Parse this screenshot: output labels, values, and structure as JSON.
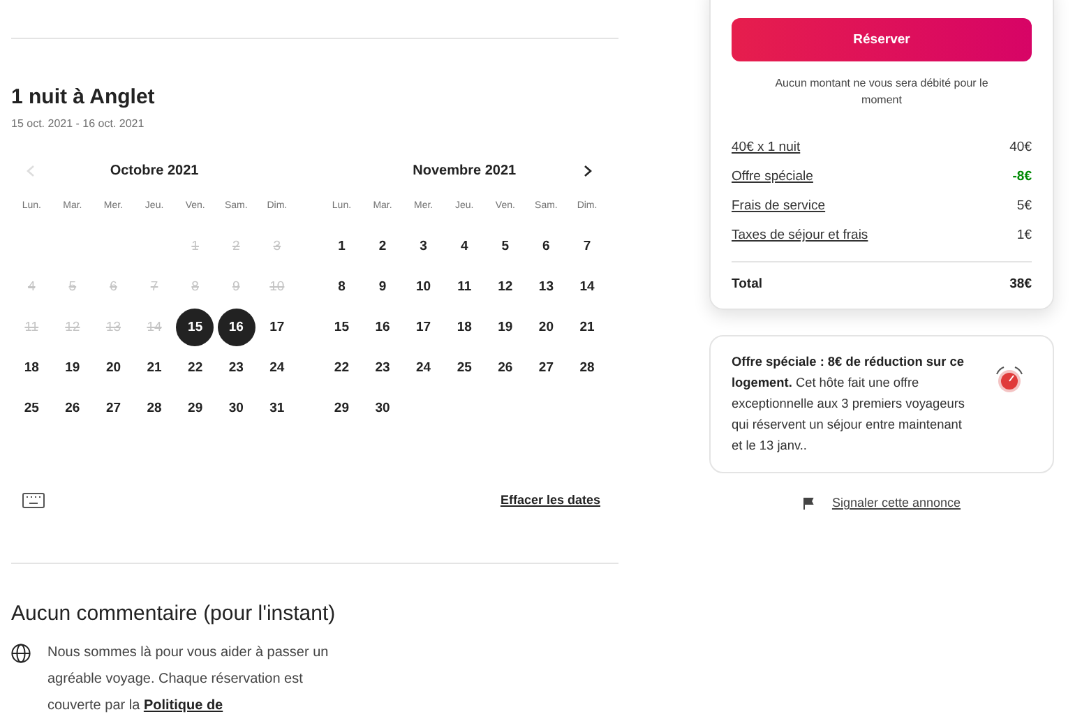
{
  "stay": {
    "title": "1 nuit à Anglet",
    "dates": "15 oct. 2021 - 16 oct. 2021"
  },
  "calendar": {
    "months": [
      {
        "title": "Octobre  2021",
        "prev_arrow": {
          "disabled": true
        },
        "weekdays": [
          "Lun.",
          "Mar.",
          "Mer.",
          "Jeu.",
          "Ven.",
          "Sam.",
          "Dim."
        ],
        "weeks": [
          {
            "right_aligned": true,
            "days": [
              {
                "label": "1",
                "disabled": true,
                "selected": false
              },
              {
                "label": "2",
                "disabled": true,
                "selected": false
              },
              {
                "label": "3",
                "disabled": true,
                "selected": false
              }
            ]
          },
          {
            "days": [
              {
                "label": "4",
                "disabled": true,
                "selected": false
              },
              {
                "label": "5",
                "disabled": true,
                "selected": false
              },
              {
                "label": "6",
                "disabled": true,
                "selected": false
              },
              {
                "label": "7",
                "disabled": true,
                "selected": false
              },
              {
                "label": "8",
                "disabled": true,
                "selected": false
              },
              {
                "label": "9",
                "disabled": true,
                "selected": false
              },
              {
                "label": "10",
                "disabled": true,
                "selected": false
              }
            ]
          },
          {
            "days": [
              {
                "label": "11",
                "disabled": true,
                "selected": false
              },
              {
                "label": "12",
                "disabled": true,
                "selected": false
              },
              {
                "label": "13",
                "disabled": true,
                "selected": false
              },
              {
                "label": "14",
                "disabled": true,
                "selected": false
              },
              {
                "label": "15",
                "disabled": false,
                "selected": true
              },
              {
                "label": "16",
                "disabled": false,
                "selected": true
              },
              {
                "label": "17",
                "disabled": false,
                "selected": false
              }
            ]
          },
          {
            "days": [
              {
                "label": "18",
                "disabled": false,
                "selected": false
              },
              {
                "label": "19",
                "disabled": false,
                "selected": false
              },
              {
                "label": "20",
                "disabled": false,
                "selected": false
              },
              {
                "label": "21",
                "disabled": false,
                "selected": false
              },
              {
                "label": "22",
                "disabled": false,
                "selected": false
              },
              {
                "label": "23",
                "disabled": false,
                "selected": false
              },
              {
                "label": "24",
                "disabled": false,
                "selected": false
              }
            ]
          },
          {
            "days": [
              {
                "label": "25",
                "disabled": false,
                "selected": false
              },
              {
                "label": "26",
                "disabled": false,
                "selected": false
              },
              {
                "label": "27",
                "disabled": false,
                "selected": false
              },
              {
                "label": "28",
                "disabled": false,
                "selected": false
              },
              {
                "label": "29",
                "disabled": false,
                "selected": false
              },
              {
                "label": "30",
                "disabled": false,
                "selected": false
              },
              {
                "label": "31",
                "disabled": false,
                "selected": false
              }
            ]
          }
        ]
      },
      {
        "title": "Novembre  2021",
        "next_arrow": {
          "disabled": false
        },
        "weekdays": [
          "Lun.",
          "Mar.",
          "Mer.",
          "Jeu.",
          "Ven.",
          "Sam.",
          "Dim."
        ],
        "weeks": [
          {
            "days": [
              {
                "label": "1",
                "disabled": false,
                "selected": false
              },
              {
                "label": "2",
                "disabled": false,
                "selected": false
              },
              {
                "label": "3",
                "disabled": false,
                "selected": false
              },
              {
                "label": "4",
                "disabled": false,
                "selected": false
              },
              {
                "label": "5",
                "disabled": false,
                "selected": false
              },
              {
                "label": "6",
                "disabled": false,
                "selected": false
              },
              {
                "label": "7",
                "disabled": false,
                "selected": false
              }
            ]
          },
          {
            "days": [
              {
                "label": "8",
                "disabled": false,
                "selected": false
              },
              {
                "label": "9",
                "disabled": false,
                "selected": false
              },
              {
                "label": "10",
                "disabled": false,
                "selected": false
              },
              {
                "label": "11",
                "disabled": false,
                "selected": false
              },
              {
                "label": "12",
                "disabled": false,
                "selected": false
              },
              {
                "label": "13",
                "disabled": false,
                "selected": false
              },
              {
                "label": "14",
                "disabled": false,
                "selected": false
              }
            ]
          },
          {
            "days": [
              {
                "label": "15",
                "disabled": false,
                "selected": false
              },
              {
                "label": "16",
                "disabled": false,
                "selected": false
              },
              {
                "label": "17",
                "disabled": false,
                "selected": false
              },
              {
                "label": "18",
                "disabled": false,
                "selected": false
              },
              {
                "label": "19",
                "disabled": false,
                "selected": false
              },
              {
                "label": "20",
                "disabled": false,
                "selected": false
              },
              {
                "label": "21",
                "disabled": false,
                "selected": false
              }
            ]
          },
          {
            "days": [
              {
                "label": "22",
                "disabled": false,
                "selected": false
              },
              {
                "label": "23",
                "disabled": false,
                "selected": false
              },
              {
                "label": "24",
                "disabled": false,
                "selected": false
              },
              {
                "label": "25",
                "disabled": false,
                "selected": false
              },
              {
                "label": "26",
                "disabled": false,
                "selected": false
              },
              {
                "label": "27",
                "disabled": false,
                "selected": false
              },
              {
                "label": "28",
                "disabled": false,
                "selected": false
              }
            ]
          },
          {
            "days": [
              {
                "label": "29",
                "disabled": false,
                "selected": false
              },
              {
                "label": "30",
                "disabled": false,
                "selected": false
              }
            ]
          }
        ]
      }
    ],
    "clear_link": "Effacer les dates"
  },
  "reviews": {
    "heading": "Aucun commentaire (pour l'instant)",
    "text": "Nous sommes là pour vous aider à passer un agréable voyage. Chaque réservation est couverte par la",
    "link": "Politique de"
  },
  "booking": {
    "button": "Réserver",
    "note": "Aucun montant ne vous sera débité pour le moment",
    "lines": [
      {
        "label": "40€ x 1 nuit",
        "amount": "40€",
        "kind": "charge"
      },
      {
        "label": "Offre spéciale",
        "amount": "-8€",
        "kind": "discount"
      },
      {
        "label": "Frais de service",
        "amount": "5€",
        "kind": "charge"
      },
      {
        "label": "Taxes de séjour et frais",
        "amount": "1€",
        "kind": "charge"
      }
    ],
    "total": {
      "label": "Total",
      "amount": "38€"
    }
  },
  "offer": {
    "text": "**Offre spéciale : 8€ de réduction sur ce logement.**  Cet hôte fait une offre exceptionnelle aux 3 premiers voyageurs qui réservent un séjour entre maintenant et le 13 janv.."
  },
  "report_link": "Signaler cette annonce"
}
